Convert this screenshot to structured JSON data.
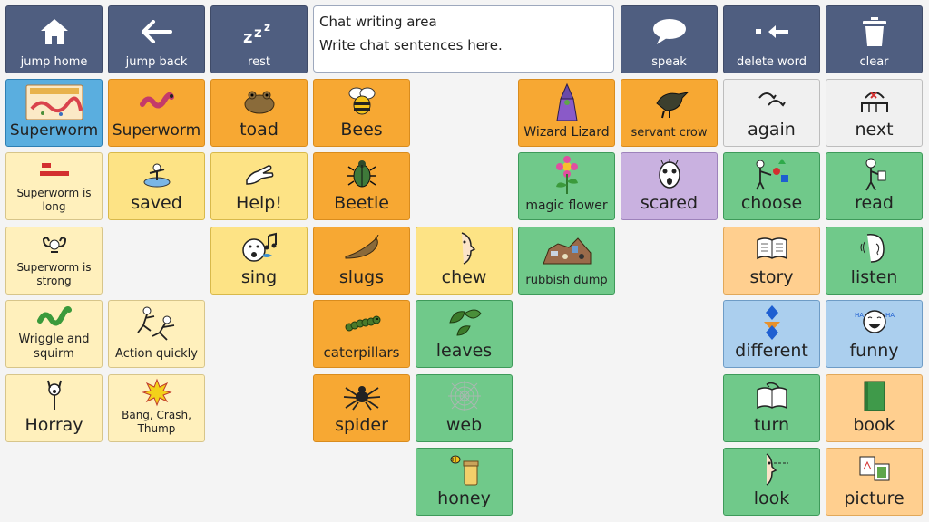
{
  "toolbar": {
    "jump_home": "jump home",
    "jump_back": "jump back",
    "rest": "rest",
    "speak": "speak",
    "delete_word": "delete word",
    "clear": "clear"
  },
  "chat": {
    "title": "Chat writing area",
    "hint": "Write chat sentences here."
  },
  "cells": {
    "superworm_book": "Superworm",
    "superworm": "Superworm",
    "toad": "toad",
    "bees": "Bees",
    "wizard_lizard": "Wizard Lizard",
    "servant_crow": "servant crow",
    "again": "again",
    "next": "next",
    "superworm_long": "Superworm is long",
    "saved": "saved",
    "help": "Help!",
    "beetle": "Beetle",
    "magic_flower": "magic flower",
    "scared": "scared",
    "choose": "choose",
    "read": "read",
    "superworm_strong": "Superworm is strong",
    "sing": "sing",
    "slugs": "slugs",
    "chew": "chew",
    "rubbish_dump": "rubbish dump",
    "story": "story",
    "listen": "listen",
    "wriggle": "Wriggle and squirm",
    "action_quickly": "Action quickly",
    "caterpillars": "caterpillars",
    "leaves": "leaves",
    "different": "different",
    "funny": "funny",
    "horray": "Horray",
    "bang_crash": "Bang, Crash, Thump",
    "spider": "spider",
    "web": "web",
    "turn": "turn",
    "book": "book",
    "honey": "honey",
    "look": "look",
    "picture": "picture"
  },
  "colors": {
    "toolbar": "#4f5e80",
    "orange": "#f7a833",
    "yellow": "#fde385",
    "cream": "#fff0bc",
    "green": "#70c98a",
    "purple": "#c9b1e0",
    "white": "#f0f0f0",
    "blue": "#abcfee",
    "peach": "#ffcf8f",
    "sky": "#5aaedf"
  }
}
